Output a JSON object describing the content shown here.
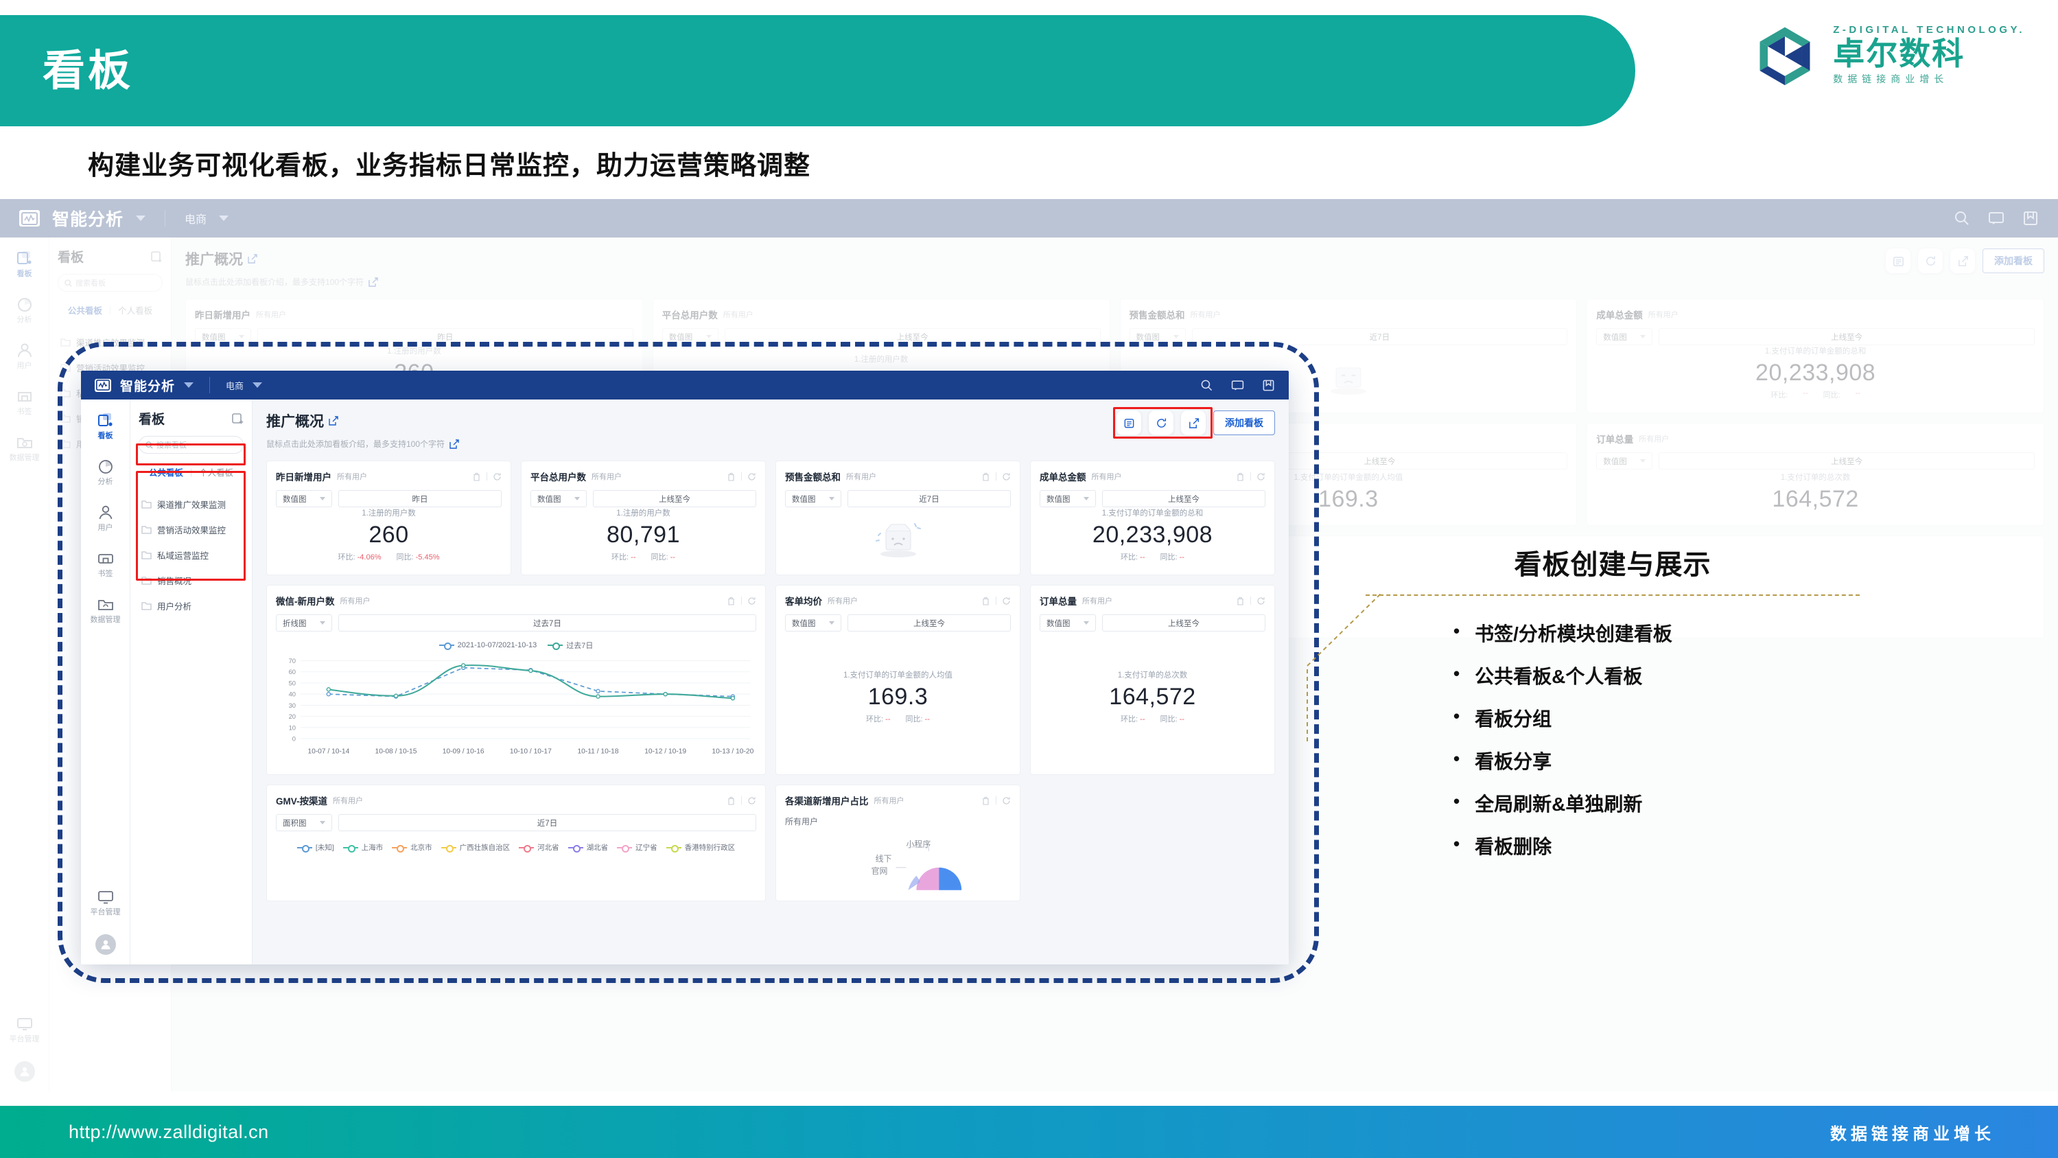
{
  "slide": {
    "title": "看板",
    "subtitle": "构建业务可视化看板，业务指标日常监控，助力运营策略调整"
  },
  "logo": {
    "en": "Z-DIGITAL TECHNOLOGY.",
    "cn": "卓尔数科",
    "slogan": "数据链接商业增长"
  },
  "app": {
    "brand": "智能分析",
    "sector": "电商",
    "topbar_icons": [
      "search-icon",
      "message-icon",
      "book-icon"
    ],
    "rail": [
      {
        "label": "看板",
        "icon": "dashboard-icon",
        "active": true
      },
      {
        "label": "分析",
        "icon": "pie-chart-icon",
        "active": false
      },
      {
        "label": "用户",
        "icon": "user-icon",
        "active": false
      },
      {
        "label": "书签",
        "icon": "bookmark-icon",
        "active": false
      },
      {
        "label": "数据管理",
        "icon": "data-folder-icon",
        "active": false
      }
    ],
    "rail_bottom": {
      "label": "平台管理",
      "icon": "monitor-icon"
    },
    "list_panel": {
      "title": "看板",
      "add_icon": "add-board-icon",
      "search_placeholder": "搜索看板",
      "tab_public": "公共看板",
      "tab_personal": "个人看板",
      "folders": [
        "渠道推广效果监测",
        "营销活动效果监控",
        "私域运营监控",
        "销售概况",
        "用户分析"
      ]
    },
    "board": {
      "title": "推广概况",
      "description": "鼠标点击此处添加看板介绍，最多支持100个字符",
      "actions": {
        "note_icon": "note-icon",
        "refresh_icon": "refresh-icon",
        "share_icon": "share-icon",
        "add_label": "添加看板"
      }
    },
    "cards": [
      {
        "title": "昨日新增用户",
        "scope": "所有用户",
        "chart_type": "数值图",
        "range": "昨日",
        "metric_label": "1.注册的用户数",
        "value": "260",
        "mom_label": "环比:",
        "mom_value": "-4.06%",
        "yoy_label": "同比:",
        "yoy_value": "-5.45%",
        "state": "value"
      },
      {
        "title": "平台总用户数",
        "scope": "所有用户",
        "chart_type": "数值图",
        "range": "上线至今",
        "metric_label": "1.注册的用户数",
        "value": "80,791",
        "mom_label": "环比:",
        "mom_value": "--",
        "yoy_label": "同比:",
        "yoy_value": "--",
        "state": "value"
      },
      {
        "title": "预售金额总和",
        "scope": "所有用户",
        "chart_type": "数值图",
        "range": "近7日",
        "metric_label": "",
        "value": "",
        "mom_label": "",
        "mom_value": "",
        "yoy_label": "",
        "yoy_value": "",
        "state": "empty"
      },
      {
        "title": "成单总金额",
        "scope": "所有用户",
        "chart_type": "数值图",
        "range": "上线至今",
        "metric_label": "1.支付订单的订单金额的总和",
        "value": "20,233,908",
        "mom_label": "环比:",
        "mom_value": "--",
        "yoy_label": "同比:",
        "yoy_value": "--",
        "state": "value"
      },
      {
        "title": "客单均价",
        "scope": "所有用户",
        "chart_type": "数值图",
        "range": "上线至今",
        "metric_label": "1.支付订单的订单金额的人均值",
        "value": "169.3",
        "mom_label": "环比:",
        "mom_value": "--",
        "yoy_label": "同比:",
        "yoy_value": "--",
        "state": "value"
      },
      {
        "title": "订单总量",
        "scope": "所有用户",
        "chart_type": "数值图",
        "range": "上线至今",
        "metric_label": "1.支付订单的总次数",
        "value": "164,572",
        "mom_label": "环比:",
        "mom_value": "--",
        "yoy_label": "同比:",
        "yoy_value": "--",
        "state": "value"
      }
    ],
    "line_card": {
      "title": "微信-新用户数",
      "scope": "所有用户",
      "chart_type": "折线图",
      "range": "过去7日"
    },
    "area_card": {
      "title": "GMV-按渠道",
      "scope": "所有用户",
      "chart_type": "面积图",
      "range": "近7日",
      "legend": [
        "[未知]",
        "上海市",
        "北京市",
        "广西壮族自治区",
        "河北省",
        "湖北省",
        "辽宁省",
        "香港特别行政区"
      ]
    },
    "pie_card": {
      "title": "各渠道新增用户占比",
      "scope": "所有用户",
      "note": "所有用户",
      "labels": [
        "小程序",
        "线下",
        "官网"
      ]
    }
  },
  "chart_data": [
    {
      "type": "line",
      "title": "微信-新用户数",
      "xlabel": "",
      "ylabel": "",
      "ylim": [
        0,
        70
      ],
      "yticks": [
        0,
        10,
        20,
        30,
        40,
        50,
        60,
        70
      ],
      "grid": true,
      "legend_position": "top",
      "categories": [
        "10-07 / 10-14",
        "10-08 / 10-15",
        "10-09 / 10-16",
        "10-10 / 10-17",
        "10-11 / 10-18",
        "10-12 / 10-19",
        "10-13 / 10-20"
      ],
      "series": [
        {
          "name": "2021-10-07/2021-10-13",
          "color": "#5b9bd5",
          "style": "dashed",
          "values": [
            40,
            38,
            64,
            62,
            43,
            41,
            38
          ]
        },
        {
          "name": "过去7日",
          "color": "#3fa99a",
          "style": "solid",
          "values": [
            44,
            39,
            66,
            63,
            39,
            41,
            37
          ]
        }
      ]
    },
    {
      "type": "area",
      "title": "GMV-按渠道",
      "legend_position": "top",
      "series": [
        {
          "name": "[未知]",
          "color": "#5b9bd5"
        },
        {
          "name": "上海市",
          "color": "#3fc0a8"
        },
        {
          "name": "北京市",
          "color": "#f5a25d"
        },
        {
          "name": "广西壮族自治区",
          "color": "#f2cc48"
        },
        {
          "name": "河北省",
          "color": "#f07a8a"
        },
        {
          "name": "湖北省",
          "color": "#8b7ee8"
        },
        {
          "name": "辽宁省",
          "color": "#f4a3c8"
        },
        {
          "name": "香港特别行政区",
          "color": "#c8d94e"
        }
      ]
    },
    {
      "type": "pie",
      "title": "各渠道新增用户占比",
      "labels": [
        "小程序",
        "线下",
        "官网"
      ],
      "colors": [
        "#4a8ff0",
        "#e8a0d8",
        "#9aa8f0"
      ]
    }
  ],
  "annotation": {
    "title": "看板创建与展示",
    "bullets": [
      "书签/分析模块创建看板",
      "公共看板&个人看板",
      "看板分组",
      "看板分享",
      "全局刷新&单独刷新",
      "看板删除"
    ]
  },
  "footer": {
    "url": "http://www.zalldigital.cn",
    "slogan": "数据链接商业增长"
  }
}
